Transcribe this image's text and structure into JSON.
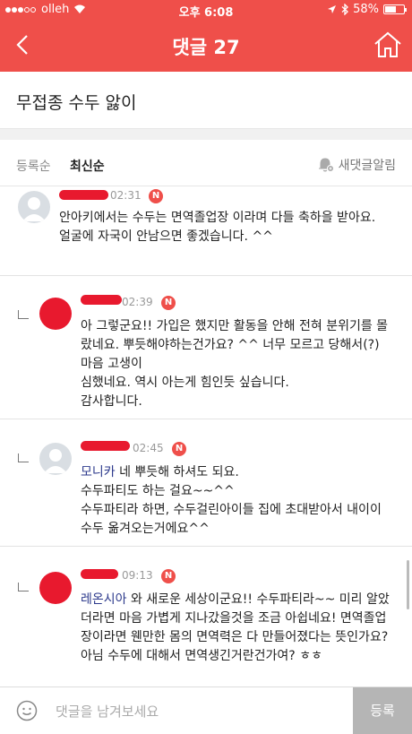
{
  "status": {
    "carrier": "olleh",
    "time": "오후 6:08",
    "battery": "58%",
    "battery_level": 0.58
  },
  "nav": {
    "title": "댓글 27"
  },
  "post": {
    "title": "무접종 수두 앓이"
  },
  "sort": {
    "oldest": "등록순",
    "newest": "최신순",
    "alarm": "새댓글알림"
  },
  "comments": [
    {
      "time": "02:31",
      "badge": "N",
      "text": "안아키에서는 수두는 면역졸업장 이라며 다들 축하을 받아요.\n얼굴에 자국이 안남으면 좋겠습니다. ^^"
    },
    {
      "time": "02:39",
      "badge": "N",
      "text": "아 그렇군요!!  가입은 했지만 활동을 안해 전혀 분위기를 몰랐네요.  뿌듯해야하는건가요?  ^^ 너무 모르고 당해서(?) 마음 고생이\n심했네요.  역시 아는게 힘인듯 싶습니다.\n감사합니다."
    },
    {
      "time": "02:45",
      "badge": "N",
      "mention": "모니카",
      "text": " 네 뿌듯해 하셔도 되요.\n수두파티도 하는 걸요~~^^\n수두파티라 하면, 수두걸린아이들 집에 초대받아서 내이이 수두 옮겨오는거에요^^"
    },
    {
      "time": "09:13",
      "badge": "N",
      "mention": "레온시아",
      "text": " 와 새로운 세상이군요!!  수두파티라~~  미리 알았더라면 마음 가볍게 지나갔을것을 조금 아쉽네요!  면역졸업장이라면 웬만한 몸의 면역력은 다 만들어졌다는 뜻인가요? 아님 수두에 대해서 면역생긴거란건가여? ㅎㅎ"
    }
  ],
  "input": {
    "placeholder": "댓글을 남겨보세요",
    "submit": "등록"
  }
}
